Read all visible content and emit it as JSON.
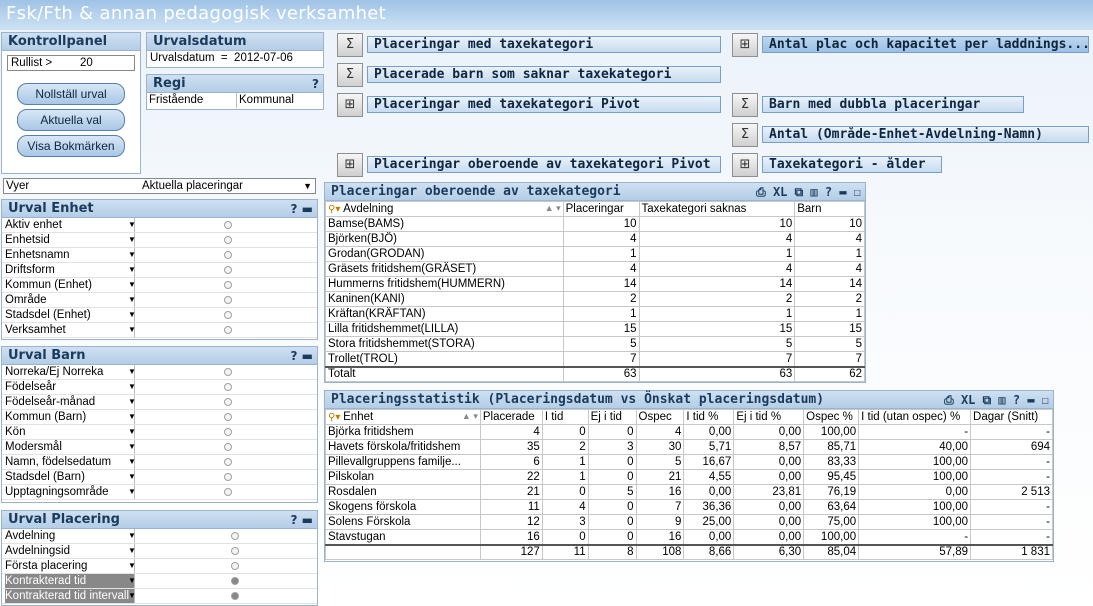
{
  "app_title": "Fsk/Fth & annan pedagogisk verksamhet",
  "kontrollpanel": {
    "title": "Kontrollpanel",
    "rullist_label": "Rullist >",
    "rullist_value": "20",
    "buttons": [
      "Nollställ urval",
      "Aktuella val",
      "Visa Bokmärken"
    ]
  },
  "urvalsdatum": {
    "title": "Urvalsdatum",
    "text": "Urvalsdatum  =  2012-07-06"
  },
  "regi": {
    "title": "Regi",
    "help": "?",
    "options": [
      "Fristående",
      "Kommunal"
    ]
  },
  "sheet_buttons": [
    "Placeringar med taxekategori",
    "Antal plac och kapacitet per laddnings...",
    "Placerade barn som saknar taxekategori",
    "Placeringar med taxekategori Pivot",
    "Barn med dubbla placeringar",
    "Antal (Område-Enhet-Avdelning-Namn)",
    "Placeringar oberoende av taxekategori Pivot",
    "Taxekategori - ålder"
  ],
  "vyer": {
    "label": "Vyer",
    "value": "Aktuella placeringar"
  },
  "urval_enhet": {
    "title": "Urval Enhet",
    "ctrls": "? ▬",
    "fields": [
      "Aktiv enhet",
      "Enhetsid",
      "Enhetsnamn",
      "Driftsform",
      "Kommun (Enhet)",
      "Område",
      "Stadsdel (Enhet)",
      "Verksamhet"
    ]
  },
  "urval_barn": {
    "title": "Urval Barn",
    "ctrls": "? ▬",
    "fields": [
      "Norreka/Ej Norreka",
      "Födelseår",
      "Födelseår-månad",
      "Kommun (Barn)",
      "Kön",
      "Modersmål",
      "Namn, födelsedatum",
      "Stadsdel (Barn)",
      "Upptagningsområde"
    ]
  },
  "urval_placering": {
    "title": "Urval Placering",
    "ctrls": "? ▬",
    "fields": [
      "Avdelning",
      "Avdelningsid",
      "Första placering",
      "Kontrakterad tid",
      "Kontrakterad tid intervall"
    ]
  },
  "table1": {
    "title": "Placeringar oberoende av taxekategori",
    "ctrls": "⎙ XL ⧉ ▥ ? ▬ ☐",
    "headers": [
      "Avdelning",
      "Placeringar",
      "Taxekategori saknas",
      "Barn"
    ],
    "rows": [
      [
        "Bamse(BAMS)",
        "10",
        "10",
        "10"
      ],
      [
        "Björken(BJÖ)",
        "4",
        "4",
        "4"
      ],
      [
        "Grodan(GRODAN)",
        "1",
        "1",
        "1"
      ],
      [
        "Gräsets fritidshem(GRÄSET)",
        "4",
        "4",
        "4"
      ],
      [
        "Hummerns fritidshem(HUMMERN)",
        "14",
        "14",
        "14"
      ],
      [
        "Kaninen(KANI)",
        "2",
        "2",
        "2"
      ],
      [
        "Kräftan(KRÄFTAN)",
        "1",
        "1",
        "1"
      ],
      [
        "Lilla fritidshemmet(LILLA)",
        "15",
        "15",
        "15"
      ],
      [
        "Stora fritidshemmet(STORA)",
        "5",
        "5",
        "5"
      ],
      [
        "Trollet(TROL)",
        "7",
        "7",
        "7"
      ]
    ],
    "total": [
      "Totalt",
      "63",
      "63",
      "62"
    ]
  },
  "table2": {
    "title": "Placeringsstatistik (Placeringsdatum vs Önskat placeringsdatum)",
    "ctrls": "⎙ XL ⧉ ▥ ? ▬ ☐",
    "headers": [
      "Enhet",
      "Placerade",
      "I tid",
      "Ej i tid",
      "Ospec",
      "I tid %",
      "Ej i tid %",
      "Ospec %",
      "I tid (utan ospec) %",
      "Dagar (Snitt)"
    ],
    "rows": [
      [
        "Björka fritidshem",
        "4",
        "0",
        "0",
        "4",
        "0,00",
        "0,00",
        "100,00",
        "-",
        "-"
      ],
      [
        "Havets förskola/fritidshem",
        "35",
        "2",
        "3",
        "30",
        "5,71",
        "8,57",
        "85,71",
        "40,00",
        "694"
      ],
      [
        "Pillevallgruppens familje...",
        "6",
        "1",
        "0",
        "5",
        "16,67",
        "0,00",
        "83,33",
        "100,00",
        "-"
      ],
      [
        "Pilskolan",
        "22",
        "1",
        "0",
        "21",
        "4,55",
        "0,00",
        "95,45",
        "100,00",
        "-"
      ],
      [
        "Rosdalen",
        "21",
        "0",
        "5",
        "16",
        "0,00",
        "23,81",
        "76,19",
        "0,00",
        "2 513"
      ],
      [
        "Skogens förskola",
        "11",
        "4",
        "0",
        "7",
        "36,36",
        "0,00",
        "63,64",
        "100,00",
        "-"
      ],
      [
        "Solens Förskola",
        "12",
        "3",
        "0",
        "9",
        "25,00",
        "0,00",
        "75,00",
        "100,00",
        "-"
      ],
      [
        "Stavstugan",
        "16",
        "0",
        "0",
        "16",
        "0,00",
        "0,00",
        "100,00",
        "-",
        "-"
      ]
    ],
    "total": [
      "",
      "127",
      "11",
      "8",
      "108",
      "8,66",
      "6,30",
      "85,04",
      "57,89",
      "1 831"
    ]
  }
}
